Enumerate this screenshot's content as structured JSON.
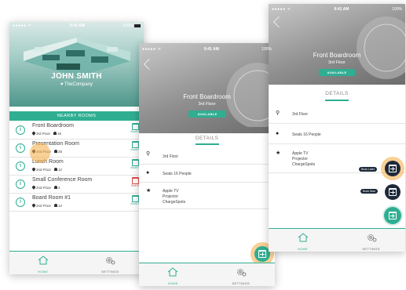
{
  "phone1": {
    "status": {
      "signal": "●●●●● ᯤ",
      "time": "9:41 AM",
      "battery": "100%"
    },
    "user_name": "JOHN SMITH",
    "company": "♥ TheCompany",
    "nearby_label": "NEARBY ROOMS",
    "rooms": [
      {
        "name": "Front Boardroom",
        "floor": "3rd Floor",
        "seats": "16",
        "action": "Book It",
        "status": "available"
      },
      {
        "name": "Presentation Room",
        "floor": "2nd Floor",
        "seats": "26",
        "action": "Book It",
        "status": "available"
      },
      {
        "name": "Lunch Room",
        "floor": "2nd Floor",
        "seats": "12",
        "action": "Book It",
        "status": "available"
      },
      {
        "name": "Small Conference Room",
        "floor": "2nd Floor",
        "seats": "4",
        "action": "End M",
        "status": "busy"
      },
      {
        "name": "Board Room #1",
        "floor": "2nd Floor",
        "seats": "12",
        "action": "Book It",
        "status": "available"
      }
    ],
    "tabs": {
      "home": "HOME",
      "settings": "SETTINGS"
    }
  },
  "phone2": {
    "status": {
      "signal": "●●●●● ᯤ",
      "time": "9:41 AM",
      "battery": "100%"
    },
    "room_title": "Front Boardroom",
    "room_floor": "3rd Floor",
    "availability": "AVAILABLE",
    "details_tab": "DETAILS",
    "details": {
      "floor": "3rd Floor",
      "seats": "Seats 16 People",
      "amenities": [
        "Apple TV",
        "Projector",
        "ChargeSpots"
      ]
    },
    "tabs": {
      "home": "HOME",
      "settings": "SETTINGS"
    }
  },
  "phone3": {
    "status": {
      "signal": "●●●●● ᯤ",
      "time": "9:41 AM",
      "battery": "100%"
    },
    "room_title": "Front Boardroom",
    "room_floor": "3rd Floor",
    "availability": "AVAILABLE",
    "details_tab": "DETAILS",
    "details": {
      "floor": "3rd Floor",
      "seats": "Seats 16 People",
      "amenities": [
        "Apple TV",
        "Projector",
        "ChargeSpots"
      ]
    },
    "fab_menu": {
      "book_later": "Book Later",
      "book_now": "Book Now"
    },
    "tabs": {
      "home": "HOME",
      "settings": "SETTINGS"
    }
  },
  "colors": {
    "accent": "#2fae92",
    "busy": "#e04848",
    "fab_dark": "#1e2a3a",
    "highlight": "#f4aa40"
  },
  "icons": [
    "home-icon",
    "settings-icon",
    "calendar-icon",
    "pin-icon",
    "person-icon",
    "star-icon",
    "info-icon",
    "back-icon"
  ]
}
